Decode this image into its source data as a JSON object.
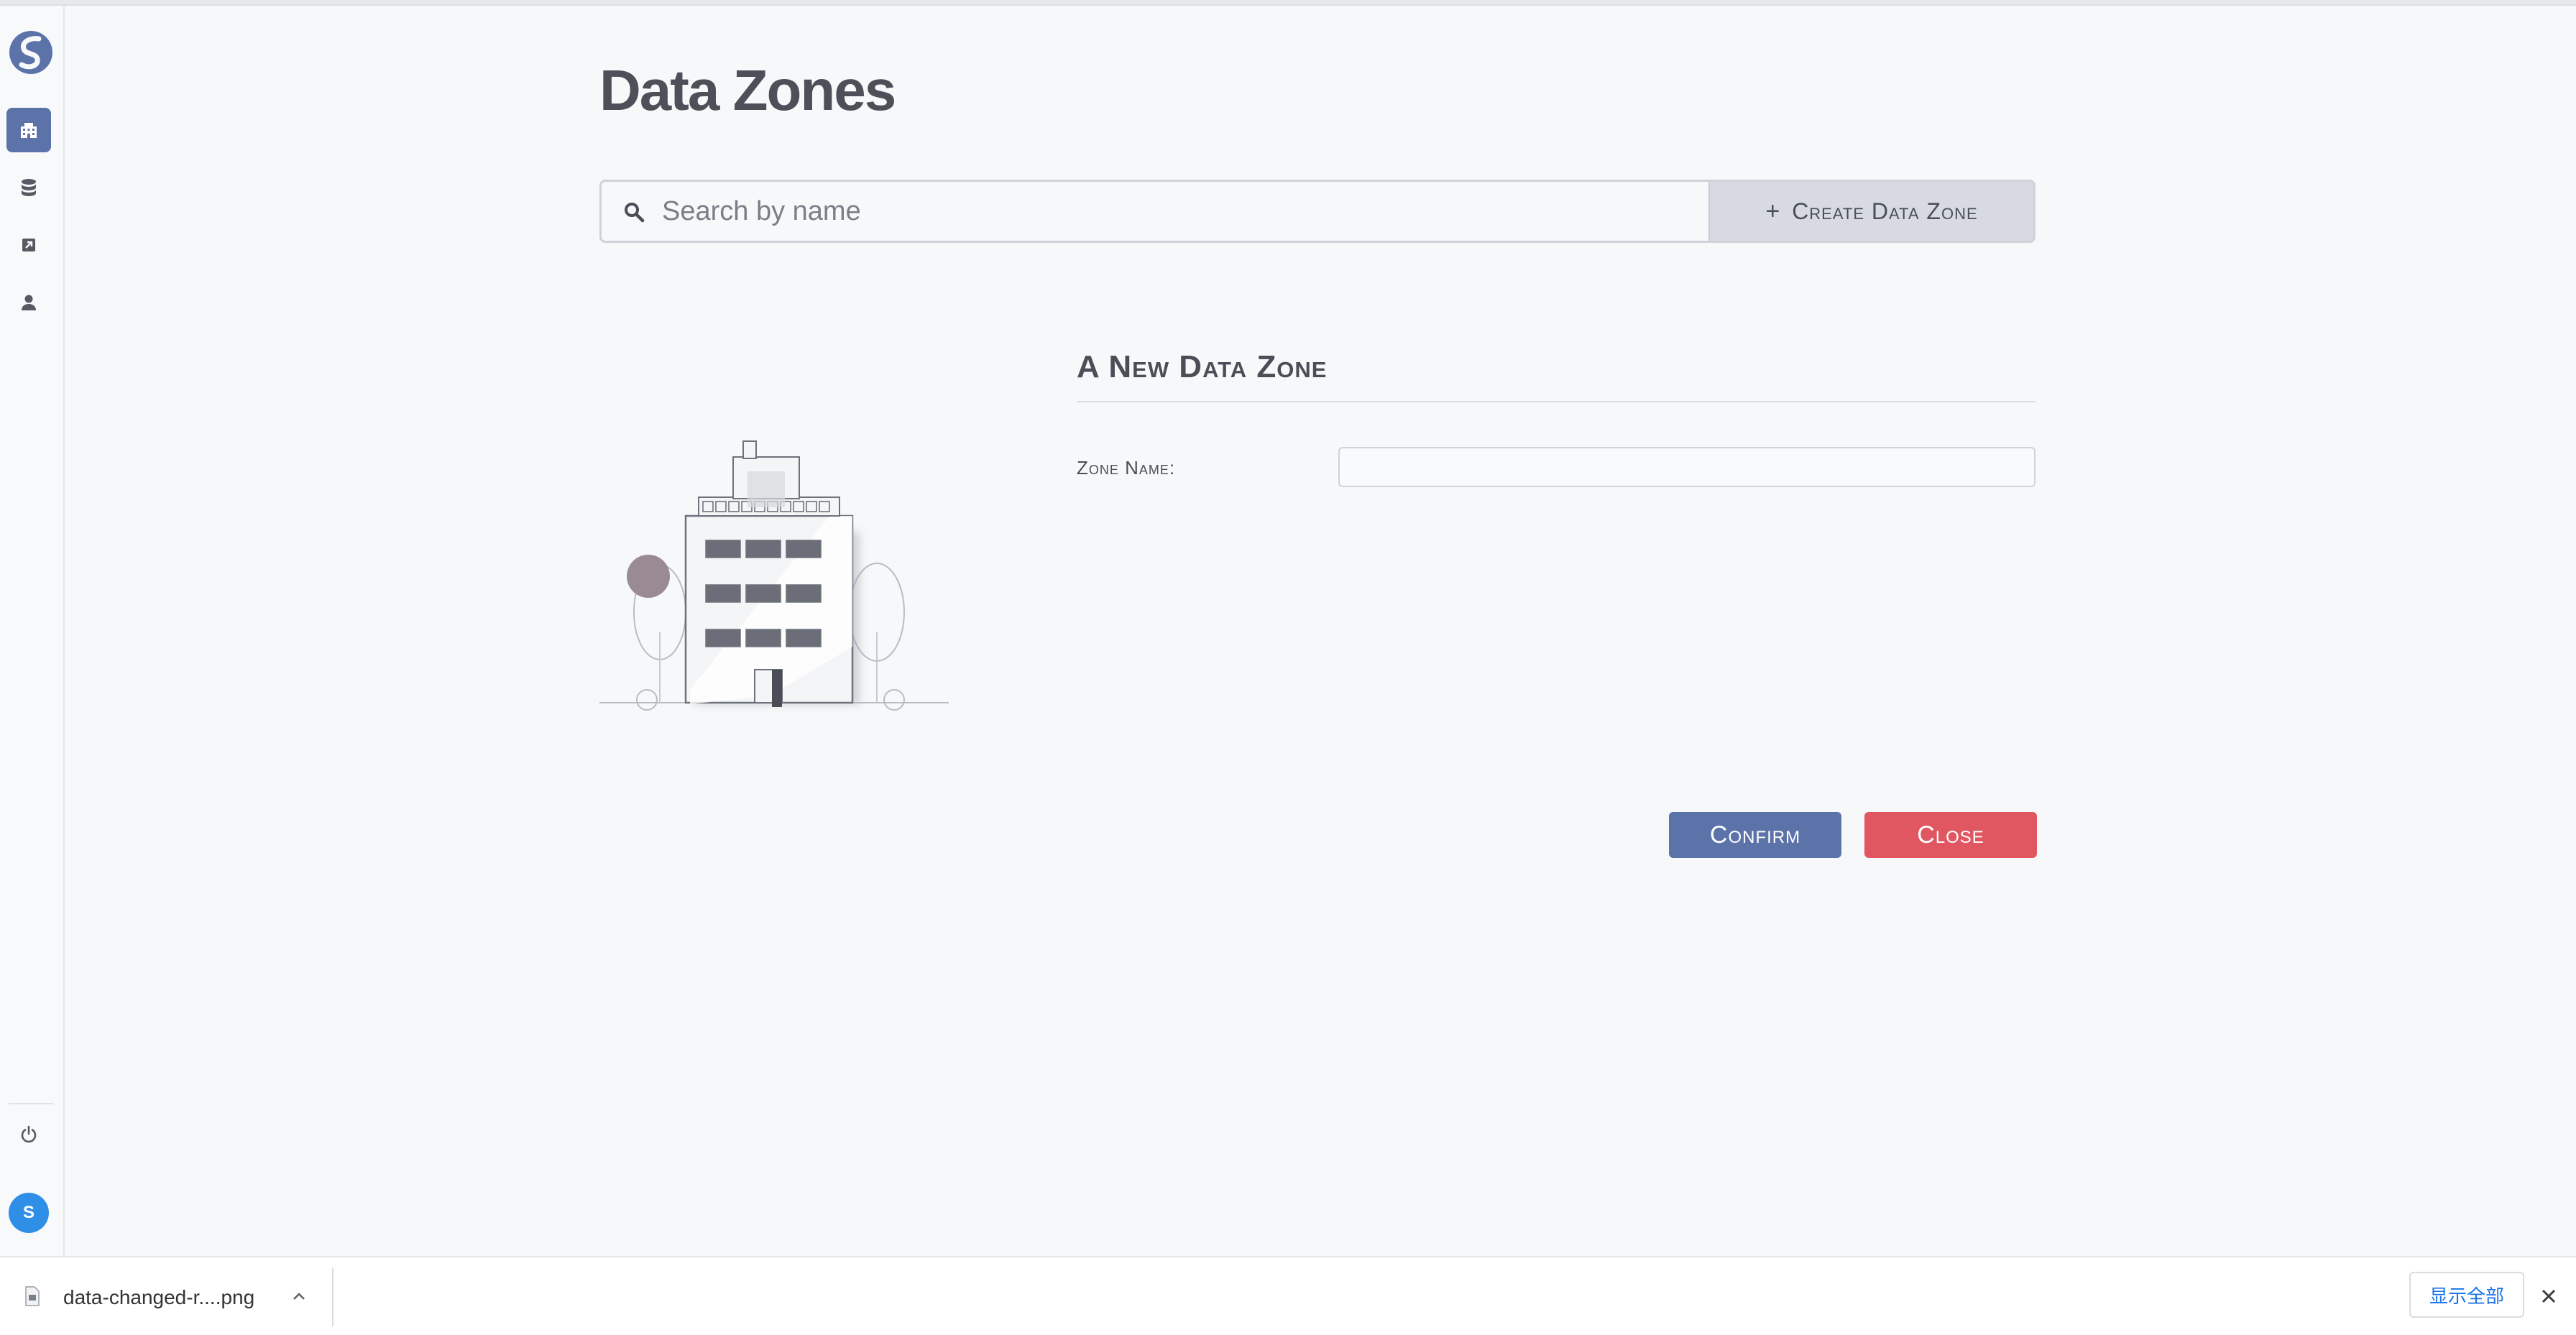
{
  "page": {
    "title": "Data Zones"
  },
  "sidebar": {
    "items": [
      {
        "name": "data-zones",
        "icon": "building-icon",
        "active": true
      },
      {
        "name": "databases",
        "icon": "database-icon",
        "active": false
      },
      {
        "name": "shortcuts",
        "icon": "external-link-icon",
        "active": false
      },
      {
        "name": "users",
        "icon": "user-icon",
        "active": false
      }
    ],
    "logout_icon": "power-icon",
    "avatar_initial": "S"
  },
  "search": {
    "placeholder": "Search by name",
    "value": ""
  },
  "create_button": {
    "plus": "+",
    "label": "Create Data Zone"
  },
  "form": {
    "title": "A New Data Zone",
    "zone_name_label": "Zone Name:",
    "zone_name_value": "",
    "confirm_label": "Confirm",
    "close_label": "Close"
  },
  "download_bar": {
    "file_name": "data-changed-r....png",
    "show_all_label": "显示全部"
  },
  "colors": {
    "accent": "#5b73a8",
    "danger": "#e05661",
    "avatar": "#2f8fe6"
  }
}
